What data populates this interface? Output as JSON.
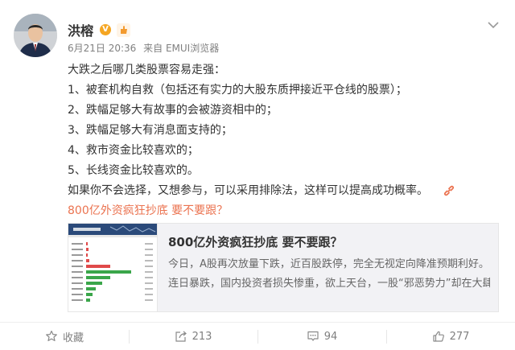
{
  "author": {
    "name": "洪榕",
    "vip_badge": "V",
    "avatar_icon": "user-avatar",
    "level_icon": "fan-level-icon"
  },
  "meta": {
    "date": "6月21日 20:36",
    "source": "来自 EMUI浏览器"
  },
  "body": {
    "lines": [
      "大跌之后哪几类股票容易走强：",
      "1、被套机构自救（包括还有实力的大股东质押接近平仓线的股票）；",
      "2、跌幅足够大有故事的会被游资相中的；",
      "3、跌幅足够大有消息面支持的；",
      "4、救市资金比较喜欢的；",
      "5、长线资金比较喜欢的。",
      "如果你不会选择，又想参与，可以采用排除法，这样可以提高成功概率。"
    ],
    "link_text": "800亿外资疯狂抄底 要不要跟？"
  },
  "card": {
    "title": "800亿外资疯狂抄底 要不要跟？",
    "desc_lines": [
      "今日，A股再次放量下跌，近百股跌停，完全无视定向降准预期利好。",
      "连日暴跌，国内投资者损失惨重，欲上天台，一股“邪恶势力”却在大肆"
    ]
  },
  "actions": {
    "favorite_label": "收藏",
    "share_count": "213",
    "comment_count": "94",
    "like_count": "277"
  },
  "colors": {
    "link": "#eb7350",
    "vip": "#f5a623",
    "card_bg": "#f2f2f5"
  }
}
